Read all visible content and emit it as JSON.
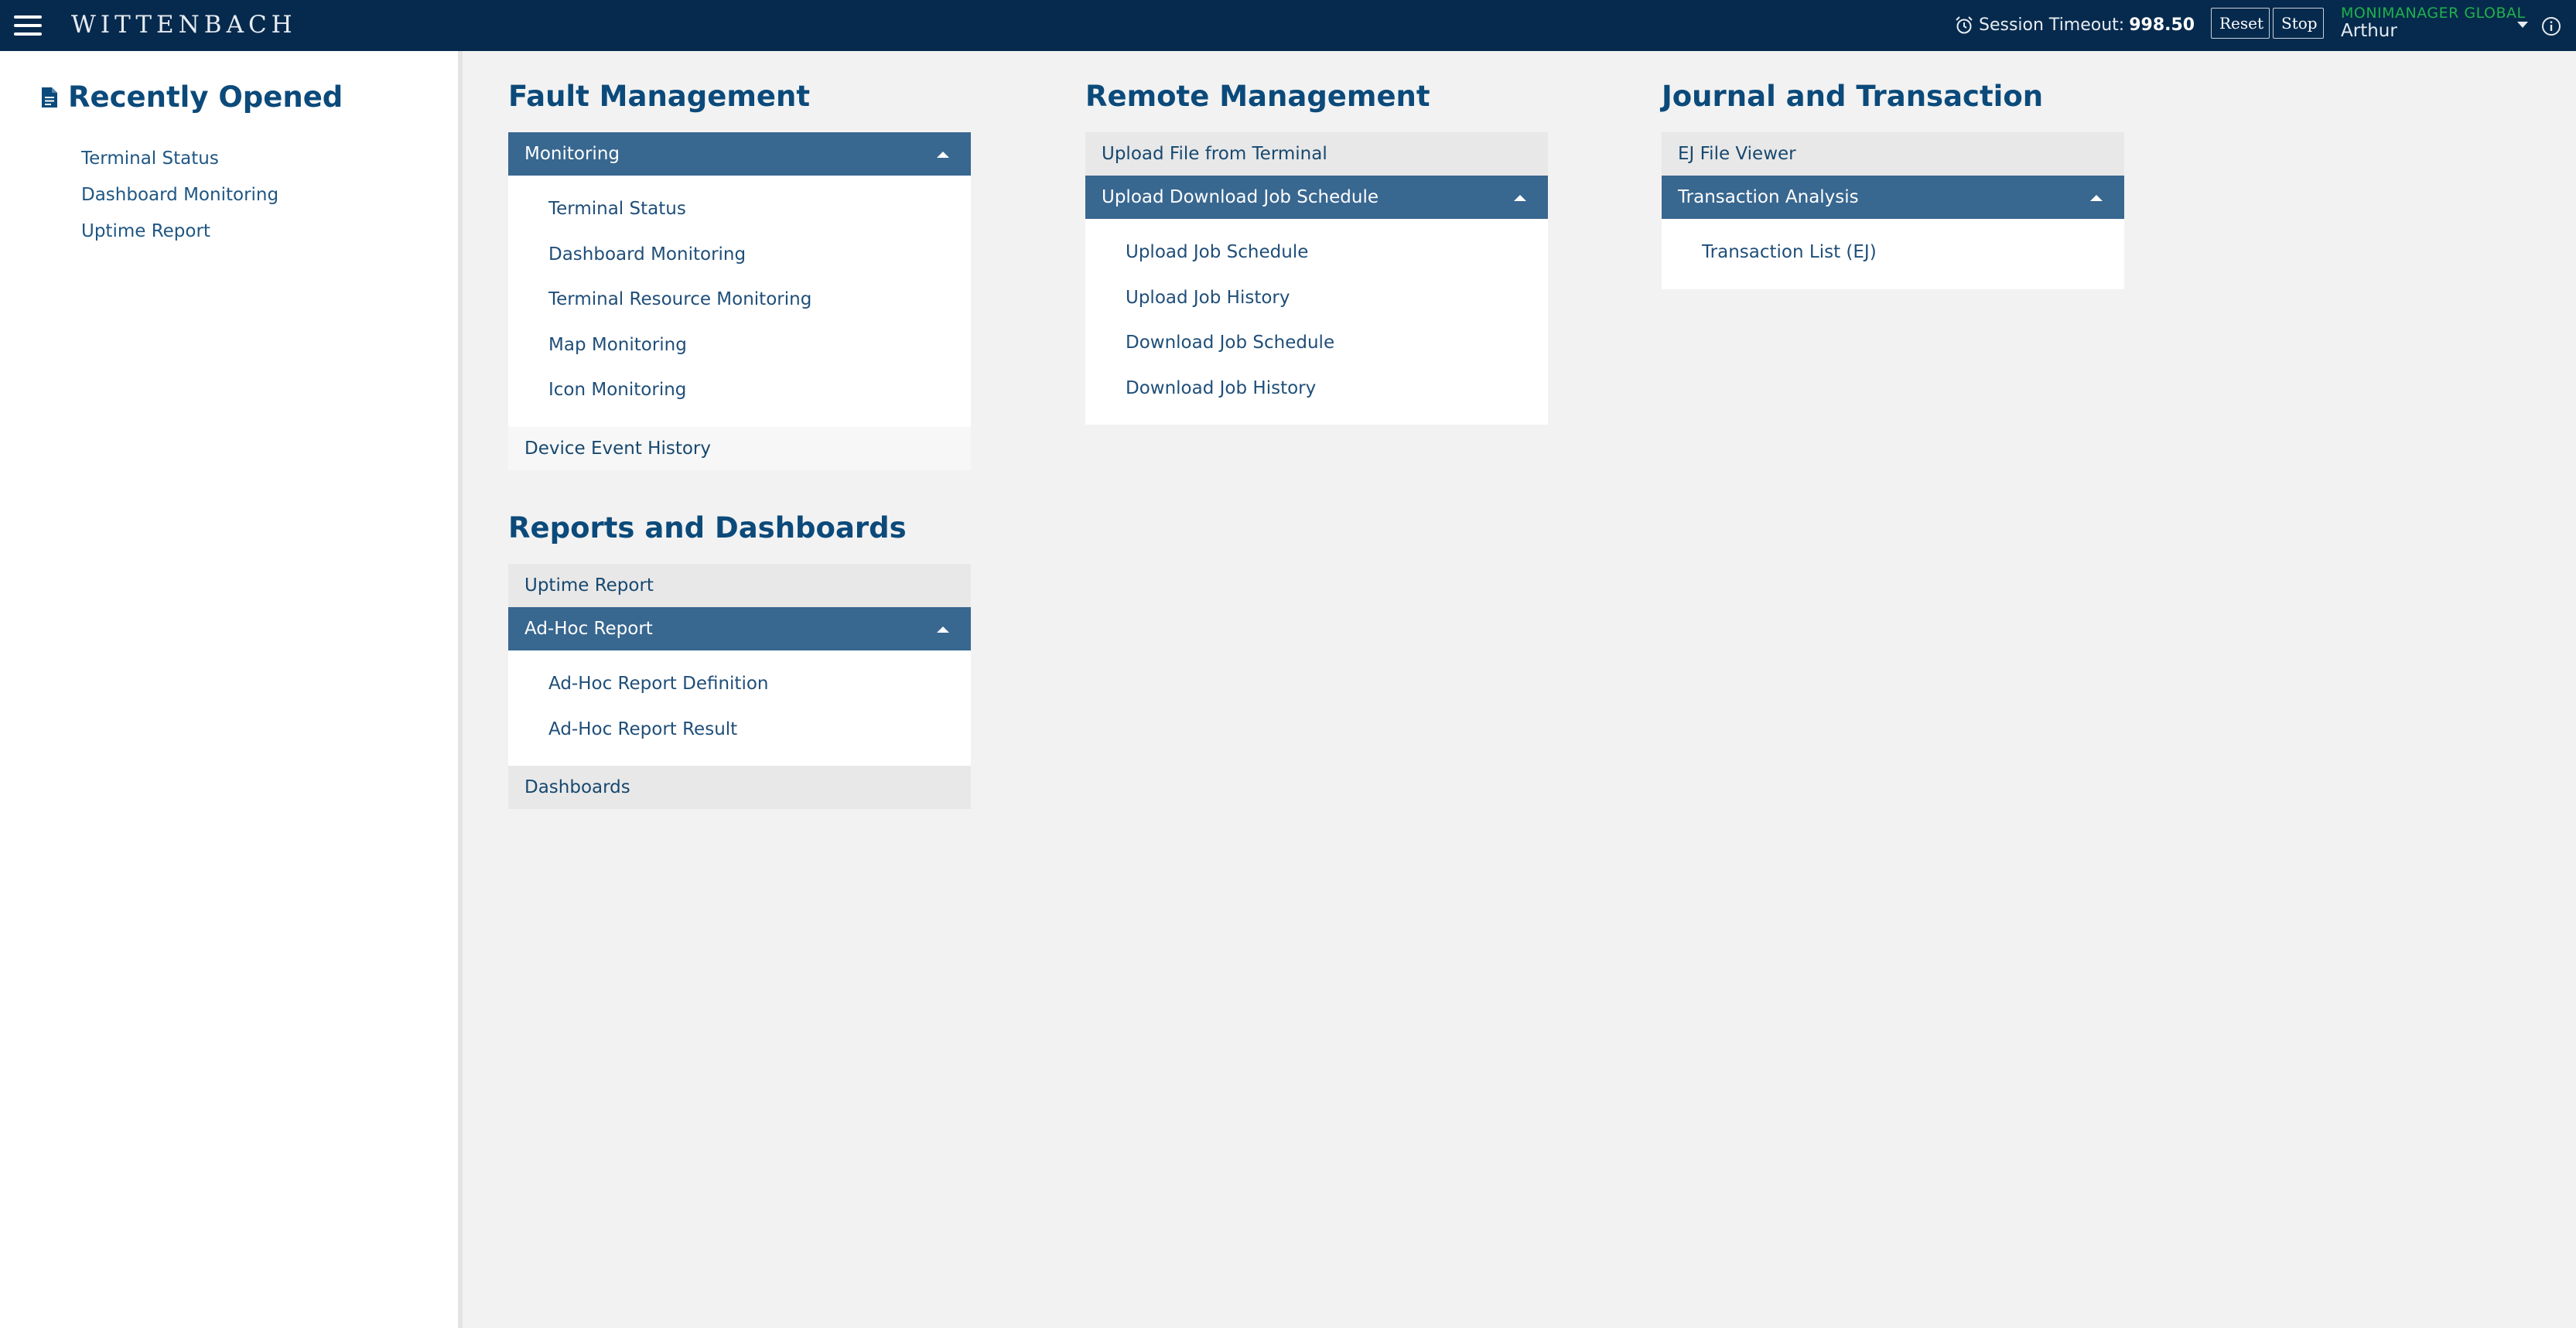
{
  "header": {
    "brand": "WITTENBACH",
    "session_label": "Session Timeout:",
    "session_value": "998.50",
    "reset_label": "Reset",
    "stop_label": "Stop",
    "organization": "MONIMANAGER GLOBAL",
    "user": "Arthur"
  },
  "sidebar": {
    "title": "Recently Opened",
    "items": [
      "Terminal Status",
      "Dashboard Monitoring",
      "Uptime Report"
    ]
  },
  "sections": {
    "fault": {
      "title": "Fault Management",
      "monitoring": {
        "label": "Monitoring",
        "items": [
          "Terminal Status",
          "Dashboard Monitoring",
          "Terminal Resource Monitoring",
          "Map Monitoring",
          "Icon Monitoring"
        ]
      },
      "device_event_history": "Device Event History"
    },
    "reports": {
      "title": "Reports and Dashboards",
      "uptime_report": "Uptime Report",
      "adhoc": {
        "label": "Ad-Hoc Report",
        "items": [
          "Ad-Hoc Report Definition",
          "Ad-Hoc Report Result"
        ]
      },
      "dashboards": "Dashboards"
    },
    "remote": {
      "title": "Remote Management",
      "upload_file": "Upload File from Terminal",
      "schedule": {
        "label": "Upload Download Job Schedule",
        "items": [
          "Upload Job Schedule",
          "Upload Job History",
          "Download Job Schedule",
          "Download Job History"
        ]
      }
    },
    "journal": {
      "title": "Journal and Transaction",
      "ej_viewer": "EJ File Viewer",
      "analysis": {
        "label": "Transaction Analysis",
        "items": [
          "Transaction List (EJ)"
        ]
      }
    }
  },
  "colors": {
    "topbar": "#062a4d",
    "accent": "#386790",
    "heading": "#0b4a7a",
    "organization": "#1fb24a"
  }
}
